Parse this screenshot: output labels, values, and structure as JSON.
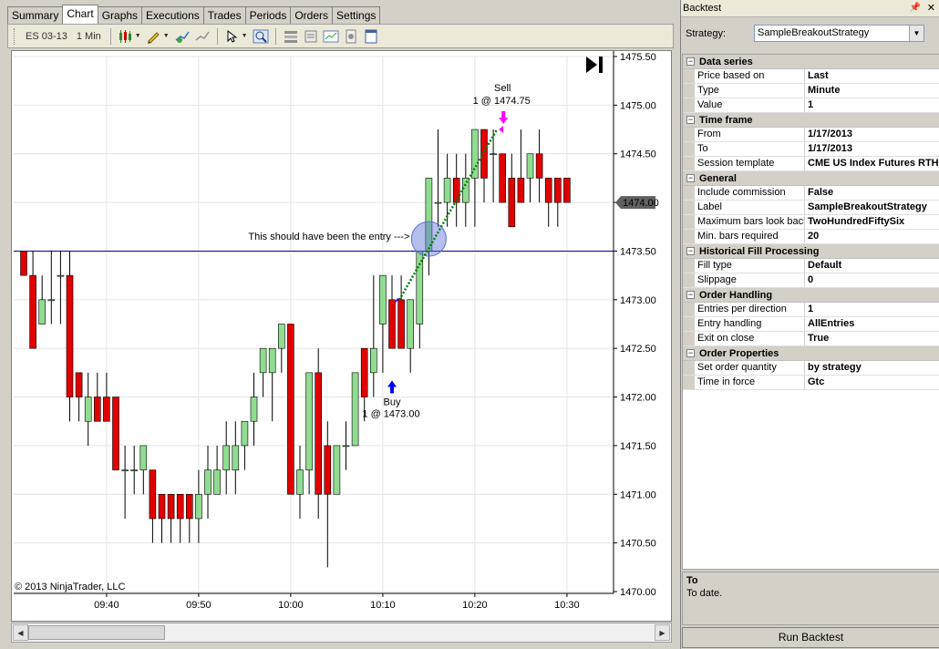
{
  "tabs": [
    {
      "label": "Summary",
      "active": false
    },
    {
      "label": "Chart",
      "active": true
    },
    {
      "label": "Graphs",
      "active": false
    },
    {
      "label": "Executions",
      "active": false
    },
    {
      "label": "Trades",
      "active": false
    },
    {
      "label": "Periods",
      "active": false
    },
    {
      "label": "Orders",
      "active": false
    },
    {
      "label": "Settings",
      "active": false
    }
  ],
  "toolbar": {
    "instrument": "ES 03-13",
    "interval": "1 Min"
  },
  "chart": {
    "copyright": "© 2013 NinjaTrader, LLC",
    "last_price": "1474.00",
    "entry_note": "This should have been the entry --->",
    "buy": {
      "label": "Buy",
      "detail": "1 @ 1473.00"
    },
    "sell": {
      "label": "Sell",
      "detail": "1 @ 1474.75"
    },
    "colors": {
      "up": "#90dc90",
      "down": "#e00000",
      "entry_line": "#0000a0",
      "trade_line": "#008000",
      "buy_arrow": "#0000ff",
      "sell_arrow": "#ff00ff",
      "highlight": "#5b6fd6"
    }
  },
  "chart_data": {
    "type": "candlestick",
    "ylim": [
      1470.0,
      1475.5
    ],
    "y_ticks": [
      "1475.50",
      "1475.00",
      "1474.50",
      "1474.00",
      "1473.50",
      "1473.00",
      "1472.50",
      "1472.00",
      "1471.50",
      "1471.00",
      "1470.50",
      "1470.00"
    ],
    "x_ticks": [
      "09:40",
      "09:50",
      "10:00",
      "10:10",
      "10:20",
      "10:30"
    ],
    "entry_level": 1473.5,
    "bars": [
      {
        "t": "09:31",
        "o": 1473.5,
        "h": 1473.5,
        "l": 1473.25,
        "c": 1473.25
      },
      {
        "t": "09:32",
        "o": 1473.25,
        "h": 1473.5,
        "l": 1472.5,
        "c": 1472.5
      },
      {
        "t": "09:33",
        "o": 1472.75,
        "h": 1473.25,
        "l": 1472.75,
        "c": 1473.0
      },
      {
        "t": "09:34",
        "o": 1473.0,
        "h": 1473.5,
        "l": 1472.75,
        "c": 1473.0
      },
      {
        "t": "09:35",
        "o": 1473.25,
        "h": 1473.5,
        "l": 1472.75,
        "c": 1473.25
      },
      {
        "t": "09:36",
        "o": 1473.25,
        "h": 1473.5,
        "l": 1471.75,
        "c": 1472.0
      },
      {
        "t": "09:37",
        "o": 1472.25,
        "h": 1472.25,
        "l": 1471.75,
        "c": 1472.0
      },
      {
        "t": "09:38",
        "o": 1471.75,
        "h": 1472.25,
        "l": 1471.5,
        "c": 1472.0
      },
      {
        "t": "09:39",
        "o": 1472.0,
        "h": 1472.25,
        "l": 1471.75,
        "c": 1471.75
      },
      {
        "t": "09:40",
        "o": 1472.0,
        "h": 1472.25,
        "l": 1471.75,
        "c": 1471.75
      },
      {
        "t": "09:41",
        "o": 1472.0,
        "h": 1472.0,
        "l": 1471.5,
        "c": 1471.25
      },
      {
        "t": "09:42",
        "o": 1471.25,
        "h": 1471.5,
        "l": 1470.75,
        "c": 1471.25
      },
      {
        "t": "09:43",
        "o": 1471.25,
        "h": 1471.5,
        "l": 1471.0,
        "c": 1471.25
      },
      {
        "t": "09:44",
        "o": 1471.25,
        "h": 1471.5,
        "l": 1471.0,
        "c": 1471.5
      },
      {
        "t": "09:45",
        "o": 1471.25,
        "h": 1471.25,
        "l": 1470.5,
        "c": 1470.75
      },
      {
        "t": "09:46",
        "o": 1471.0,
        "h": 1471.0,
        "l": 1470.5,
        "c": 1470.75
      },
      {
        "t": "09:47",
        "o": 1471.0,
        "h": 1471.0,
        "l": 1470.5,
        "c": 1470.75
      },
      {
        "t": "09:48",
        "o": 1471.0,
        "h": 1471.0,
        "l": 1470.5,
        "c": 1470.75
      },
      {
        "t": "09:49",
        "o": 1471.0,
        "h": 1471.0,
        "l": 1470.5,
        "c": 1470.75
      },
      {
        "t": "09:50",
        "o": 1470.75,
        "h": 1471.25,
        "l": 1470.5,
        "c": 1471.0
      },
      {
        "t": "09:51",
        "o": 1471.0,
        "h": 1471.5,
        "l": 1470.75,
        "c": 1471.25
      },
      {
        "t": "09:52",
        "o": 1471.0,
        "h": 1471.5,
        "l": 1471.0,
        "c": 1471.25
      },
      {
        "t": "09:53",
        "o": 1471.25,
        "h": 1471.75,
        "l": 1471.0,
        "c": 1471.5
      },
      {
        "t": "09:54",
        "o": 1471.25,
        "h": 1471.75,
        "l": 1471.0,
        "c": 1471.5
      },
      {
        "t": "09:55",
        "o": 1471.5,
        "h": 1471.75,
        "l": 1471.25,
        "c": 1471.75
      },
      {
        "t": "09:56",
        "o": 1471.75,
        "h": 1472.25,
        "l": 1471.5,
        "c": 1472.0
      },
      {
        "t": "09:57",
        "o": 1472.25,
        "h": 1472.5,
        "l": 1472.0,
        "c": 1472.5
      },
      {
        "t": "09:58",
        "o": 1472.25,
        "h": 1472.5,
        "l": 1471.75,
        "c": 1472.5
      },
      {
        "t": "09:59",
        "o": 1472.5,
        "h": 1472.75,
        "l": 1472.25,
        "c": 1472.75
      },
      {
        "t": "10:00",
        "o": 1472.75,
        "h": 1472.75,
        "l": 1471.0,
        "c": 1471.0
      },
      {
        "t": "10:01",
        "o": 1471.0,
        "h": 1471.5,
        "l": 1470.75,
        "c": 1471.25
      },
      {
        "t": "10:02",
        "o": 1471.25,
        "h": 1472.25,
        "l": 1471.0,
        "c": 1472.25
      },
      {
        "t": "10:03",
        "o": 1472.25,
        "h": 1472.5,
        "l": 1470.75,
        "c": 1471.0
      },
      {
        "t": "10:04",
        "o": 1471.5,
        "h": 1471.75,
        "l": 1470.25,
        "c": 1471.0
      },
      {
        "t": "10:05",
        "o": 1471.0,
        "h": 1471.5,
        "l": 1471.0,
        "c": 1471.5
      },
      {
        "t": "10:06",
        "o": 1471.5,
        "h": 1471.75,
        "l": 1471.25,
        "c": 1471.5
      },
      {
        "t": "10:07",
        "o": 1471.5,
        "h": 1472.25,
        "l": 1471.5,
        "c": 1472.25
      },
      {
        "t": "10:08",
        "o": 1472.5,
        "h": 1472.5,
        "l": 1471.75,
        "c": 1472.0
      },
      {
        "t": "10:09",
        "o": 1472.25,
        "h": 1473.25,
        "l": 1472.0,
        "c": 1472.5
      },
      {
        "t": "10:10",
        "o": 1472.75,
        "h": 1473.25,
        "l": 1472.25,
        "c": 1473.25
      },
      {
        "t": "10:11",
        "o": 1473.0,
        "h": 1473.25,
        "l": 1472.75,
        "c": 1472.5
      },
      {
        "t": "10:12",
        "o": 1473.0,
        "h": 1473.25,
        "l": 1472.5,
        "c": 1472.5
      },
      {
        "t": "10:13",
        "o": 1472.5,
        "h": 1473.0,
        "l": 1472.25,
        "c": 1473.0
      },
      {
        "t": "10:14",
        "o": 1472.75,
        "h": 1473.5,
        "l": 1472.5,
        "c": 1473.5
      },
      {
        "t": "10:15",
        "o": 1473.5,
        "h": 1474.25,
        "l": 1473.25,
        "c": 1474.25
      },
      {
        "t": "10:16",
        "o": 1474.0,
        "h": 1474.75,
        "l": 1473.75,
        "c": 1474.0
      },
      {
        "t": "10:17",
        "o": 1474.0,
        "h": 1474.5,
        "l": 1473.75,
        "c": 1474.25
      },
      {
        "t": "10:18",
        "o": 1474.25,
        "h": 1474.5,
        "l": 1473.75,
        "c": 1474.0
      },
      {
        "t": "10:19",
        "o": 1474.0,
        "h": 1474.5,
        "l": 1473.75,
        "c": 1474.25
      },
      {
        "t": "10:20",
        "o": 1474.25,
        "h": 1474.75,
        "l": 1473.75,
        "c": 1474.75
      },
      {
        "t": "10:21",
        "o": 1474.75,
        "h": 1474.75,
        "l": 1474.0,
        "c": 1474.25
      },
      {
        "t": "10:22",
        "o": 1474.5,
        "h": 1474.75,
        "l": 1474.0,
        "c": 1474.5
      },
      {
        "t": "10:23",
        "o": 1474.5,
        "h": 1474.5,
        "l": 1474.0,
        "c": 1474.0
      },
      {
        "t": "10:24",
        "o": 1474.25,
        "h": 1474.5,
        "l": 1473.75,
        "c": 1473.75
      },
      {
        "t": "10:25",
        "o": 1474.25,
        "h": 1474.75,
        "l": 1474.0,
        "c": 1474.0
      },
      {
        "t": "10:26",
        "o": 1474.25,
        "h": 1474.5,
        "l": 1474.0,
        "c": 1474.5
      },
      {
        "t": "10:27",
        "o": 1474.5,
        "h": 1474.75,
        "l": 1474.0,
        "c": 1474.25
      },
      {
        "t": "10:28",
        "o": 1474.25,
        "h": 1474.25,
        "l": 1473.75,
        "c": 1474.0
      },
      {
        "t": "10:29",
        "o": 1474.25,
        "h": 1474.25,
        "l": 1473.75,
        "c": 1474.0
      },
      {
        "t": "10:30",
        "o": 1474.25,
        "h": 1474.25,
        "l": 1474.0,
        "c": 1474.0
      }
    ],
    "trades": [
      {
        "side": "buy",
        "time": "10:12",
        "price": 1473.0
      },
      {
        "side": "sell",
        "time": "10:22",
        "price": 1474.75
      }
    ]
  },
  "panel": {
    "title": "Backtest",
    "strategy_label": "Strategy:",
    "strategy_value": "SampleBreakoutStrategy",
    "categories": [
      {
        "name": "Data series",
        "rows": [
          {
            "name": "Price based on",
            "value": "Last"
          },
          {
            "name": "Type",
            "value": "Minute"
          },
          {
            "name": "Value",
            "value": "1"
          }
        ]
      },
      {
        "name": "Time frame",
        "rows": [
          {
            "name": "From",
            "value": "1/17/2013"
          },
          {
            "name": "To",
            "value": "1/17/2013"
          },
          {
            "name": "Session template",
            "value": "CME US Index Futures RTH"
          }
        ]
      },
      {
        "name": "General",
        "rows": [
          {
            "name": "Include commission",
            "value": "False"
          },
          {
            "name": "Label",
            "value": "SampleBreakoutStrategy"
          },
          {
            "name": "Maximum bars look back",
            "value": "TwoHundredFiftySix"
          },
          {
            "name": "Min. bars required",
            "value": "20"
          }
        ]
      },
      {
        "name": "Historical Fill Processing",
        "rows": [
          {
            "name": "Fill type",
            "value": "Default"
          },
          {
            "name": "Slippage",
            "value": "0"
          }
        ]
      },
      {
        "name": "Order Handling",
        "rows": [
          {
            "name": "Entries per direction",
            "value": "1"
          },
          {
            "name": "Entry handling",
            "value": "AllEntries"
          },
          {
            "name": "Exit on close",
            "value": "True"
          }
        ]
      },
      {
        "name": "Order Properties",
        "rows": [
          {
            "name": "Set order quantity",
            "value": "by strategy"
          },
          {
            "name": "Time in force",
            "value": "Gtc"
          }
        ]
      }
    ],
    "description_title": "To",
    "description_text": "To date.",
    "run_button": "Run Backtest"
  }
}
